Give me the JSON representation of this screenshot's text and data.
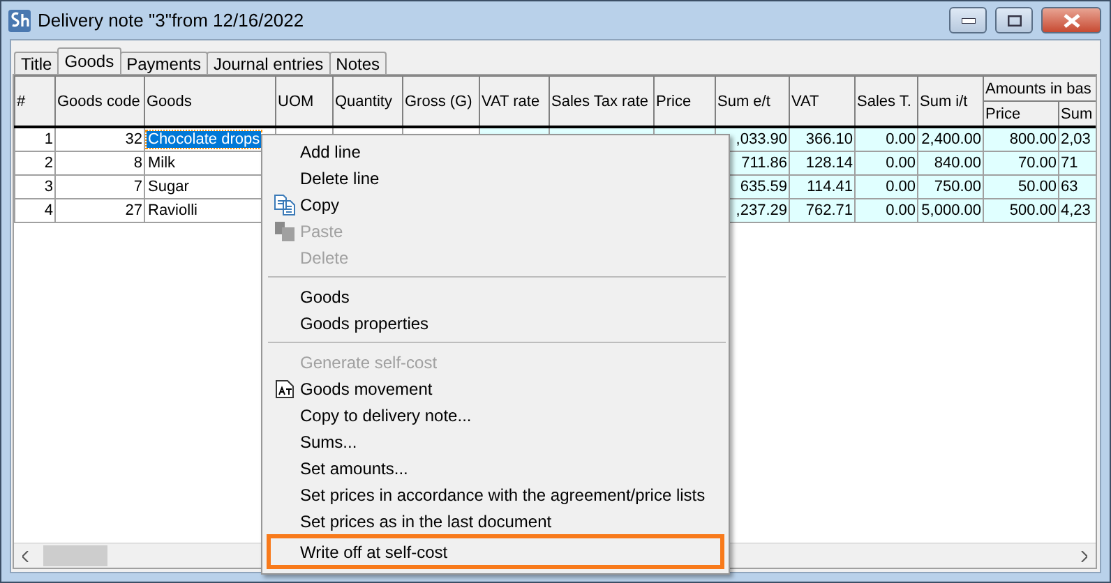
{
  "window": {
    "title": "Delivery note \"3\"from 12/16/2022"
  },
  "tabs": [
    {
      "label": "Title",
      "selected": false
    },
    {
      "label": "Goods",
      "selected": true
    },
    {
      "label": "Payments",
      "selected": false
    },
    {
      "label": "Journal entries",
      "selected": false
    },
    {
      "label": "Notes",
      "selected": false
    }
  ],
  "table": {
    "columns": [
      {
        "label": "#"
      },
      {
        "label": "Goods code"
      },
      {
        "label": "Goods"
      },
      {
        "label": "UOM"
      },
      {
        "label": "Quantity"
      },
      {
        "label": "Gross (G)"
      },
      {
        "label": "VAT rate"
      },
      {
        "label": "Sales Tax rate"
      },
      {
        "label": "Price"
      },
      {
        "label": "Sum e/t"
      },
      {
        "label": "VAT"
      },
      {
        "label": "Sales T."
      },
      {
        "label": "Sum i/t"
      },
      {
        "label": "Amounts in bas",
        "children": [
          {
            "label": "Price"
          },
          {
            "label": "Sum"
          }
        ]
      }
    ],
    "rows": [
      {
        "number": "1",
        "goods_code": "32",
        "goods": "Chocolate drops",
        "sum_et": ",033.90",
        "vat": "366.10",
        "sales_tax": "0.00",
        "sum_it": "2,400.00",
        "base_price": "800.00",
        "base_sum": "2,03",
        "selected": true
      },
      {
        "number": "2",
        "goods_code": "8",
        "goods": "Milk",
        "sum_et": "711.86",
        "vat": "128.14",
        "sales_tax": "0.00",
        "sum_it": "840.00",
        "base_price": "70.00",
        "base_sum": "71",
        "selected": false
      },
      {
        "number": "3",
        "goods_code": "7",
        "goods": "Sugar",
        "sum_et": "635.59",
        "vat": "114.41",
        "sales_tax": "0.00",
        "sum_it": "750.00",
        "base_price": "50.00",
        "base_sum": "63",
        "selected": false
      },
      {
        "number": "4",
        "goods_code": "27",
        "goods": "Raviolli",
        "sum_et": ",237.29",
        "vat": "762.71",
        "sales_tax": "0.00",
        "sum_it": "5,000.00",
        "base_price": "500.00",
        "base_sum": "4,23",
        "selected": false
      }
    ]
  },
  "context_menu": {
    "items": [
      {
        "kind": "plain",
        "label": "Add line",
        "disabled": false,
        "selected": false
      },
      {
        "kind": "plain",
        "label": "Delete line",
        "disabled": false,
        "selected": false
      },
      {
        "kind": "copy",
        "label": "Copy",
        "disabled": false,
        "selected": false
      },
      {
        "kind": "paste",
        "label": "Paste",
        "disabled": true,
        "selected": false
      },
      {
        "kind": "plain",
        "label": "Delete",
        "disabled": true,
        "selected": false
      },
      {
        "kind": "separator"
      },
      {
        "kind": "plain",
        "label": "Goods",
        "disabled": false,
        "selected": false
      },
      {
        "kind": "plain",
        "label": "Goods properties",
        "disabled": false,
        "selected": false
      },
      {
        "kind": "separator"
      },
      {
        "kind": "plain",
        "label": "Generate self-cost",
        "disabled": true,
        "selected": false
      },
      {
        "kind": "report",
        "label": "Goods movement",
        "disabled": false,
        "selected": false
      },
      {
        "kind": "plain",
        "label": "Copy to delivery note...",
        "disabled": false,
        "selected": false
      },
      {
        "kind": "plain",
        "label": "Sums...",
        "disabled": false,
        "selected": false
      },
      {
        "kind": "plain",
        "label": "Set amounts...",
        "disabled": false,
        "selected": false
      },
      {
        "kind": "plain",
        "label": "Set prices in accordance with the agreement/price lists",
        "disabled": false,
        "selected": false
      },
      {
        "kind": "plain",
        "label": "Set prices as in the last document",
        "disabled": false,
        "selected": false
      },
      {
        "kind": "plain",
        "label": "Write off at self-cost",
        "disabled": false,
        "selected": true
      }
    ]
  }
}
